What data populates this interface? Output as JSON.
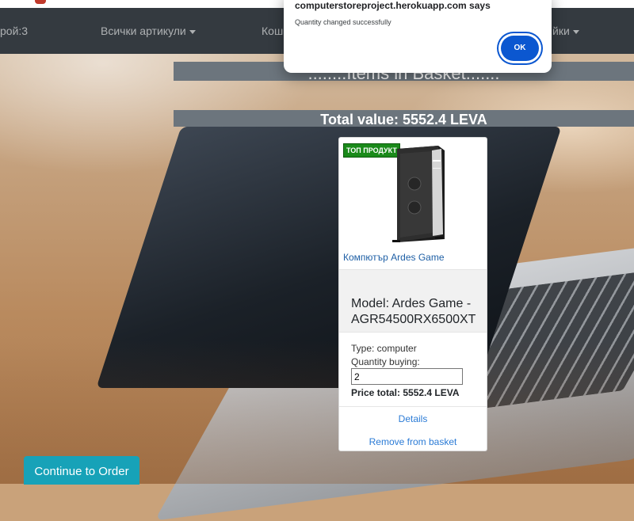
{
  "navbar": {
    "items": [
      {
        "label": "рой:3"
      },
      {
        "label": "Всички артикули"
      },
      {
        "label": "Кош"
      },
      {
        "label": "йки"
      }
    ]
  },
  "basket": {
    "heading": "........Items in Basket.......",
    "total_label": "Total value: 5552.4 LEVA"
  },
  "product": {
    "badge": "ТОП ПРОДУКТ",
    "name_link": "Компютър Ardes Game",
    "model": "Model: Ardes Game - AGR54500RX6500XT",
    "type": "Type: computer",
    "quantity_label": "Quantity buying:",
    "quantity_value": "2",
    "price_total": "Price total: 5552.4 LEVA",
    "details_link": "Details",
    "remove_link": "Remove from basket"
  },
  "continue_button": "Continue to Order",
  "alert": {
    "title": "computerstoreproject.herokuapp.com says",
    "message": "Quantity changed successfully",
    "ok_label": "OK"
  },
  "colors": {
    "navbar": "#343a40",
    "band": "#6c757d",
    "continue": "#17a2b8",
    "ok_button": "#0b57d0",
    "badge": "#1a8a1a",
    "link": "#2b7bd6"
  }
}
